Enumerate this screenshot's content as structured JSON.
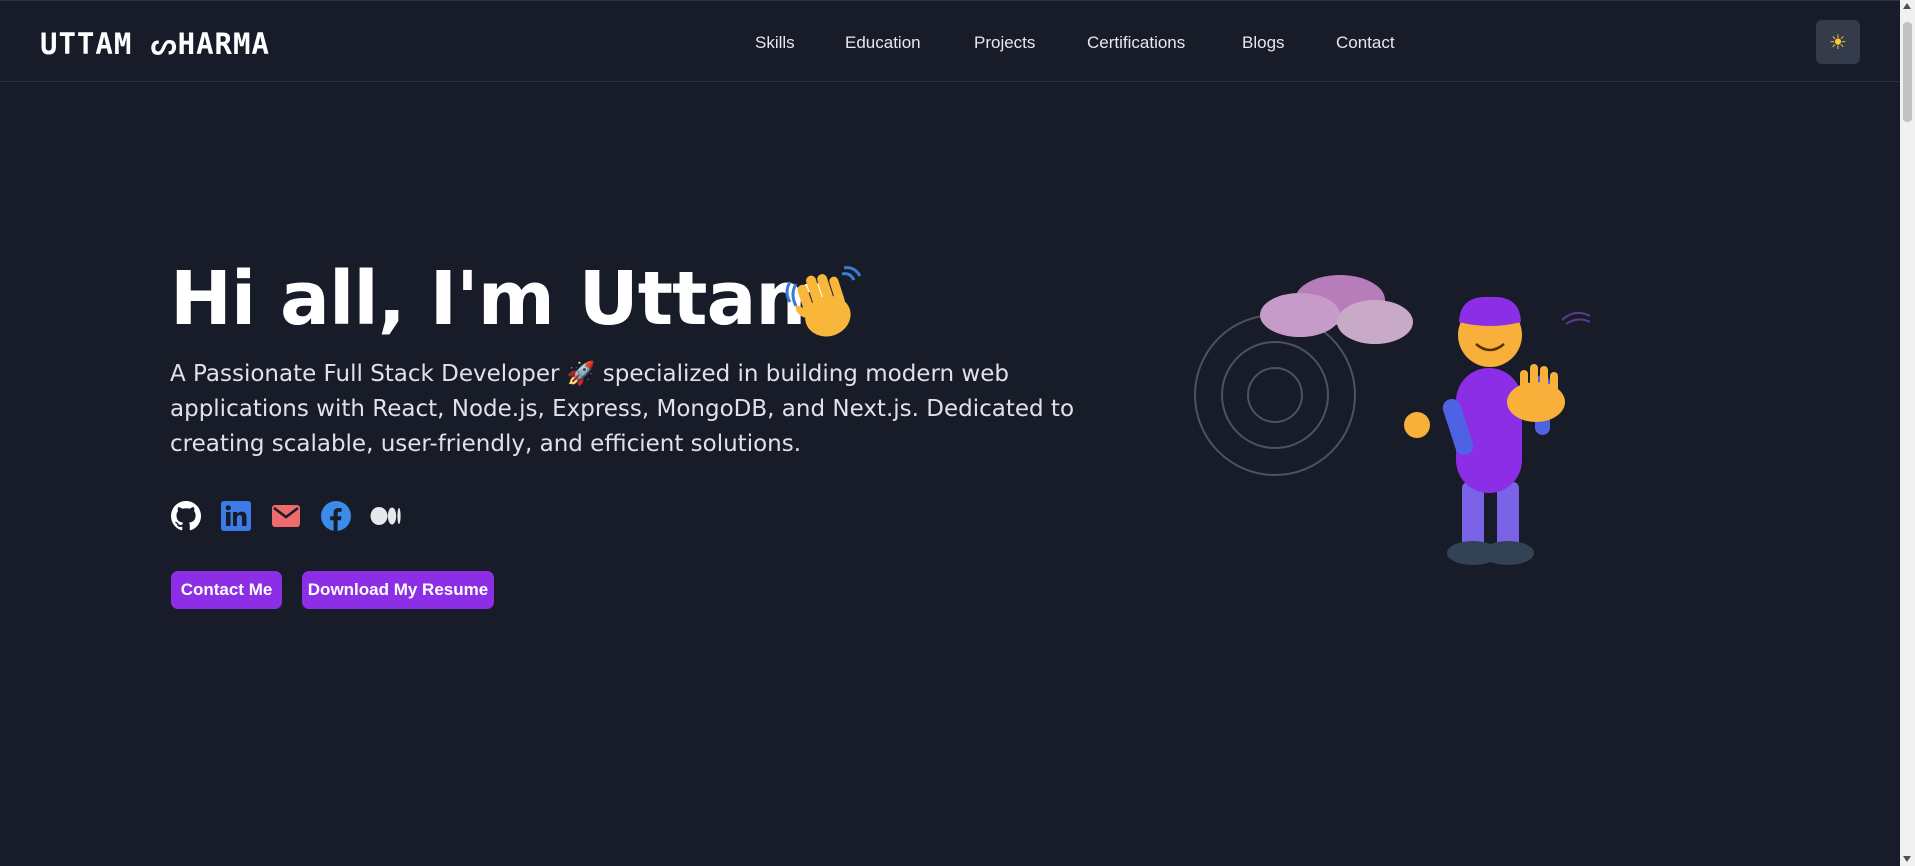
{
  "nav": {
    "logo": "UTTAM ᔕHARMA",
    "links": [
      "Skills",
      "Education",
      "Projects",
      "Certifications",
      "Blogs",
      "Contact"
    ],
    "theme_toggle_icon": "sun-icon",
    "theme_toggle_glyph": "☀"
  },
  "hero": {
    "title": "Hi all, I'm Uttam",
    "wave_icon": "waving-hand-icon",
    "description": "A Passionate Full Stack Developer 🚀 specialized in building modern web applications with React, Node.js, Express, MongoDB, and Next.js. Dedicated to creating scalable, user-friendly, and efficient solutions.",
    "social_icons": [
      "github-icon",
      "linkedin-icon",
      "email-icon",
      "facebook-icon",
      "medium-icon"
    ],
    "buttons": {
      "contact": "Contact Me",
      "resume": "Download My Resume"
    }
  },
  "colors": {
    "background": "#171c28",
    "accent": "#8c2ee6",
    "linkedin": "#3d7be8",
    "email": "#ef6b6b",
    "facebook": "#3b8be8"
  }
}
